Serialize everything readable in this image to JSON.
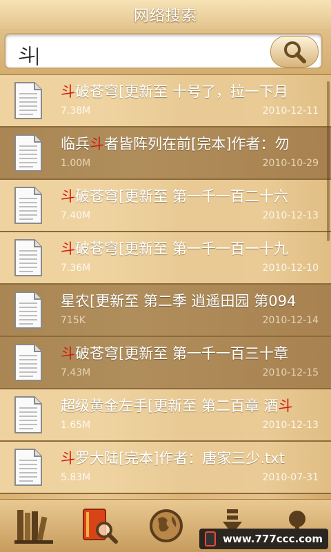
{
  "header": {
    "title": "网络搜索"
  },
  "search": {
    "value": "斗"
  },
  "results": [
    {
      "pre": "",
      "hl": "斗",
      "post": "破苍穹[更新至 十号了，拉一下月",
      "size": "7.38M",
      "date": "2010-12-11"
    },
    {
      "pre": "临兵",
      "hl": "斗",
      "post": "者皆阵列在前[完本]作者：勿",
      "size": "1.00M",
      "date": "2010-10-29"
    },
    {
      "pre": "",
      "hl": "斗",
      "post": "破苍穹[更新至 第一千一百二十六",
      "size": "7.40M",
      "date": "2010-12-13"
    },
    {
      "pre": "",
      "hl": "斗",
      "post": "破苍穹[更新至 第一千一百一十九",
      "size": "7.36M",
      "date": "2010-12-10"
    },
    {
      "pre": "星农[更新至 第二季 逍遥田园 第094",
      "hl": "",
      "post": "",
      "size": "715K",
      "date": "2010-12-14"
    },
    {
      "pre": "",
      "hl": "斗",
      "post": "破苍穹[更新至 第一千一百三十章",
      "size": "7.43M",
      "date": "2010-12-15"
    },
    {
      "pre": "超级黄金左手[更新至 第二百章 酒",
      "hl": "斗",
      "post": "",
      "size": "1.65M",
      "date": "2010-12-13"
    },
    {
      "pre": "",
      "hl": "斗",
      "post": "罗大陆[完本]作者：唐家三少.txt",
      "size": "5.83M",
      "date": "2010-07-31"
    }
  ],
  "bottom_tabs": [
    {
      "icon": "bookshelf-icon"
    },
    {
      "icon": "book-search-icon"
    },
    {
      "icon": "globe-icon"
    },
    {
      "icon": "download-icon"
    },
    {
      "icon": "pin-icon"
    }
  ],
  "watermark": {
    "text": "www.777ccc.com"
  }
}
